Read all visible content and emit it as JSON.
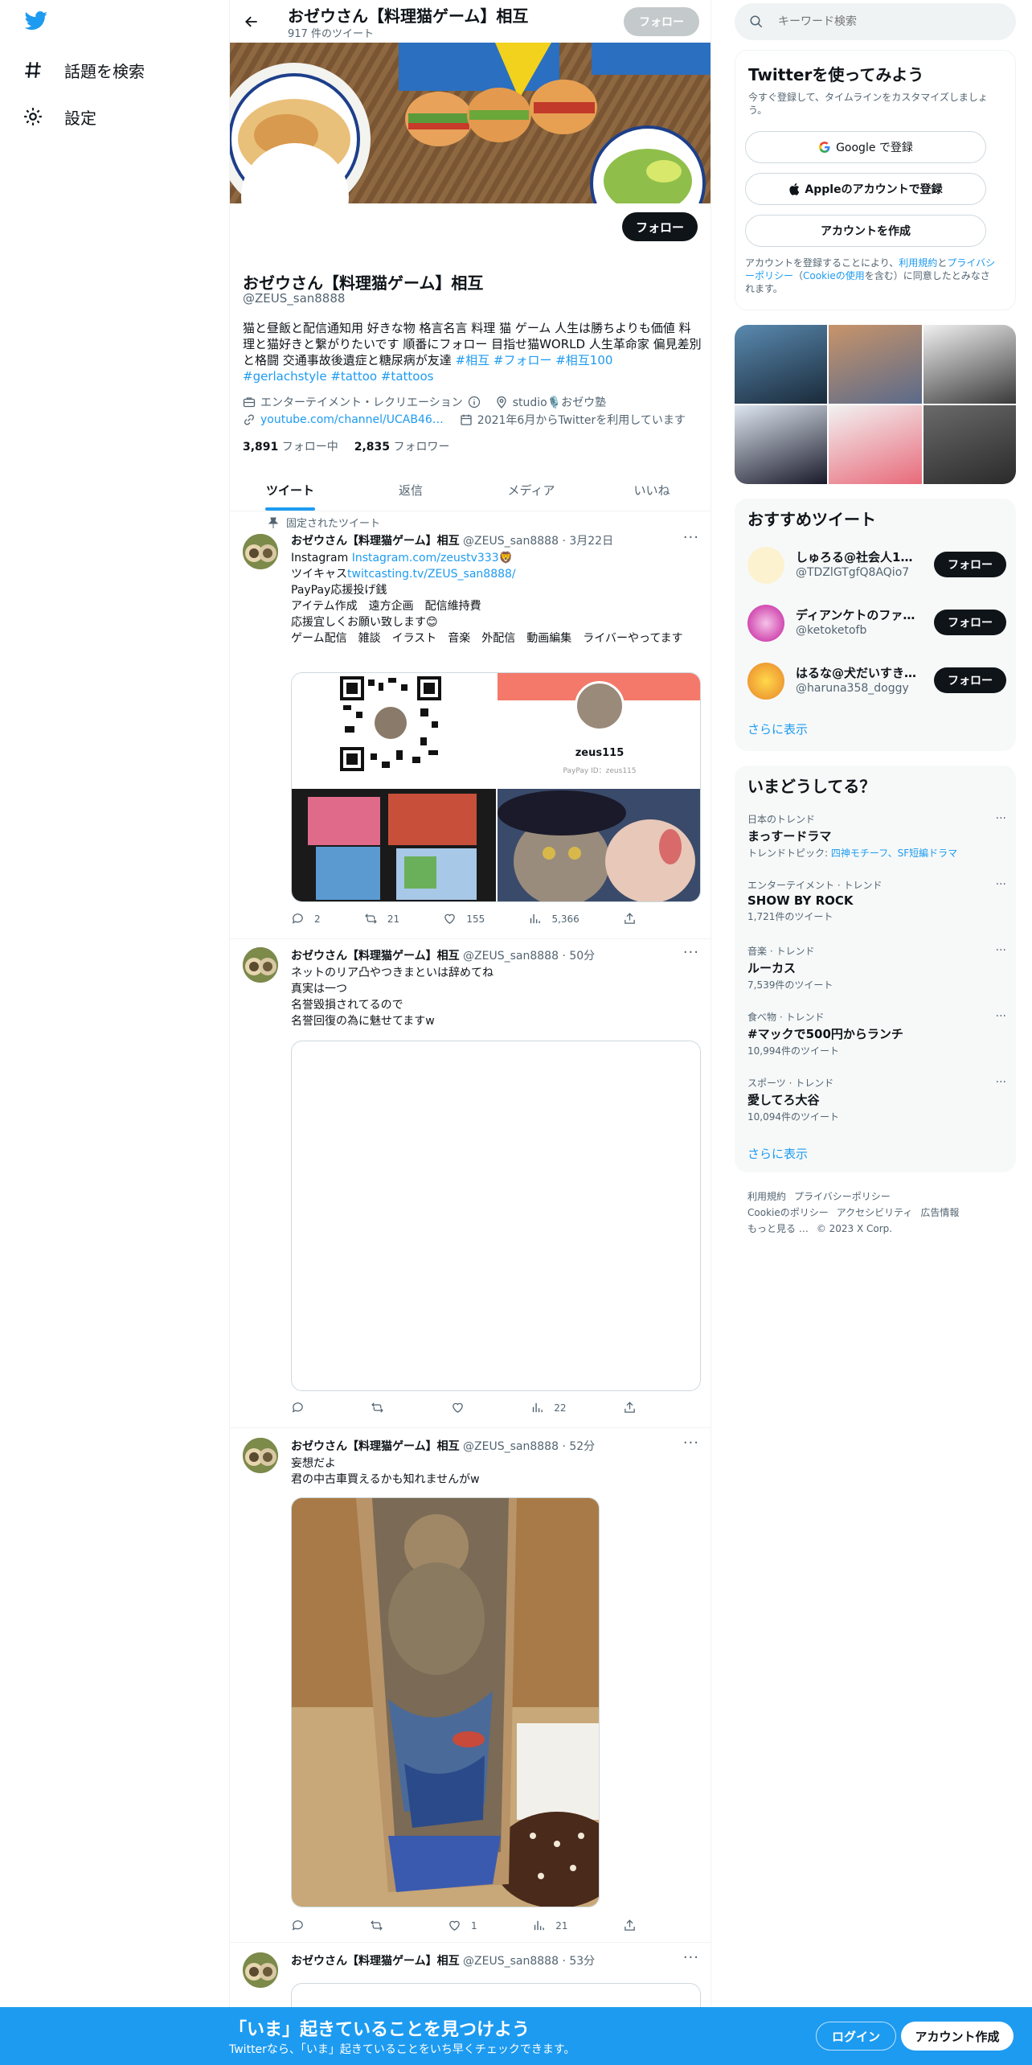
{
  "nav": {
    "explore_label": "話題を検索",
    "settings_label": "設定"
  },
  "profile": {
    "header_name": "おゼウさん【料理猫ゲーム】相互",
    "tweet_count": "917 件のツイート",
    "follow_label": "フォロー",
    "name": "おゼウさん【料理猫ゲーム】相互",
    "handle": "@ZEUS_san8888",
    "bio_text": "猫と昼飯と配信通知用 好きな物 格言名言 料理 猫 ゲーム 人生は勝ちよりも価値 料理と猫好きと繋がりたいです 順番にフォロー 目指せ猫WORLD 人生革命家 偏見差別と格闘 交通事故後遺症と糖尿病が友達 ",
    "bio_tags": "#相互 #フォロー #相互100",
    "bio_tags2": "#gerlachstyle #tattoo #tattoos",
    "category": "エンターテイメント・レクリエーション",
    "location": "studio🎙️おゼウ塾",
    "url": "youtube.com/channel/UCAB46…",
    "joined": "2021年6月からTwitterを利用しています",
    "following_count": "3,891",
    "following_label": "フォロー中",
    "followers_count": "2,835",
    "followers_label": "フォロワー"
  },
  "tabs": [
    "ツイート",
    "返信",
    "メディア",
    "いいね"
  ],
  "pinned_label": "固定されたツイート",
  "tweets": [
    {
      "name": "おゼウさん【料理猫ゲーム】相互",
      "handle_time": "@ZEUS_san8888 · 3月22日",
      "line1_prefix": "Instagram ",
      "line1_link": "Instagram.com/zeustv333",
      "line1_suffix": "🦁",
      "line2_prefix": "ツイキャス",
      "line2_link": "twitcasting.tv/ZEUS_san8888/",
      "line3": "PayPay応援投げ銭",
      "line4": "アイテム作成　遠方企画　配信維持費",
      "line5": "応援宜しくお願い致します😊",
      "line6": "ゲーム配信　雑談　イラスト　音楽　外配信　動画編集　ライバーやってます",
      "paypay_name": "zeus115",
      "paypay_id": "PayPay ID：zeus115",
      "replies": "2",
      "retweets": "21",
      "likes": "155",
      "views": "5,366"
    },
    {
      "name": "おゼウさん【料理猫ゲーム】相互",
      "handle_time": "@ZEUS_san8888 · 50分",
      "line1": "ネットのリア凸やつきまといは辞めてね",
      "line2": "真実は一つ",
      "line3": "名誉毀損されてるので",
      "line4": "名誉回復の為に魅せてますw",
      "replies": "",
      "retweets": "",
      "likes": "",
      "views": "22"
    },
    {
      "name": "おゼウさん【料理猫ゲーム】相互",
      "handle_time": "@ZEUS_san8888 · 52分",
      "line1": "妄想だよ",
      "line2": "君の中古車買えるかも知れませんがw",
      "replies": "",
      "retweets": "",
      "likes": "1",
      "views": "21"
    },
    {
      "name": "おゼウさん【料理猫ゲーム】相互",
      "handle_time": "@ZEUS_san8888 · 53分"
    }
  ],
  "sidebar": {
    "search_placeholder": "キーワード検索",
    "signup_title": "Twitterを使ってみよう",
    "signup_sub": "今すぐ登録して、タイムラインをカスタマイズしましょう。",
    "google_label": "Google で登録",
    "apple_label": "Appleのアカウントで登録",
    "create_label": "アカウントを作成",
    "legal_1": "アカウントを登録することにより、",
    "legal_link1": "利用規約",
    "legal_2": "と",
    "legal_link2": "プライバシーポリシー",
    "legal_3": "（",
    "legal_link3": "Cookieの使用",
    "legal_4": "を含む）に同意したとみなされます。",
    "rec_title": "おすすめツイート",
    "rec_users": [
      {
        "name": "しゅろる@社会人1…",
        "handle": "@TDZlGTgfQ8AQio7",
        "follow": "フォロー"
      },
      {
        "name": "ディアンケトのファ…",
        "handle": "@ketoketofb",
        "follow": "フォロー"
      },
      {
        "name": "はるな@犬だいすき…",
        "handle": "@haruna358_doggy",
        "follow": "フォロー"
      }
    ],
    "show_more": "さらに表示",
    "trends_title": "いまどうしてる？",
    "trends": [
      {
        "category": "日本のトレンド",
        "name": "まっすードラマ",
        "sub_prefix": "トレンドトピック: ",
        "sub_link": "四神モチーフ、SF短編ドラマ"
      },
      {
        "category": "エンターテイメント · トレンド",
        "name": "SHOW BY ROCK",
        "sub": "1,721件のツイート"
      },
      {
        "category": "音楽 · トレンド",
        "name": "ルーカス",
        "sub": "7,539件のツイート"
      },
      {
        "category": "食べ物 · トレンド",
        "name": "#マックで500円からランチ",
        "sub": "10,994件のツイート"
      },
      {
        "category": "スポーツ · トレンド",
        "name": "愛してろ大谷",
        "sub": "10,094件のツイート"
      }
    ],
    "trends_more": "さらに表示",
    "footer": {
      "terms": "利用規約",
      "privacy": "プライバシーポリシー",
      "cookie": "Cookieのポリシー",
      "access": "アクセシビリティ",
      "ads": "広告情報",
      "more": "もっと見る …",
      "copyright": "© 2023 X Corp."
    }
  },
  "bottombar": {
    "title": "「いま」起きていることを見つけよう",
    "sub": "Twitterなら、「いま」起きていることをいち早くチェックできます。",
    "login": "ログイン",
    "signup": "アカウント作成"
  },
  "colors": {
    "accent": "#1d9bf0",
    "text": "#0f1419",
    "muted": "#536471"
  }
}
